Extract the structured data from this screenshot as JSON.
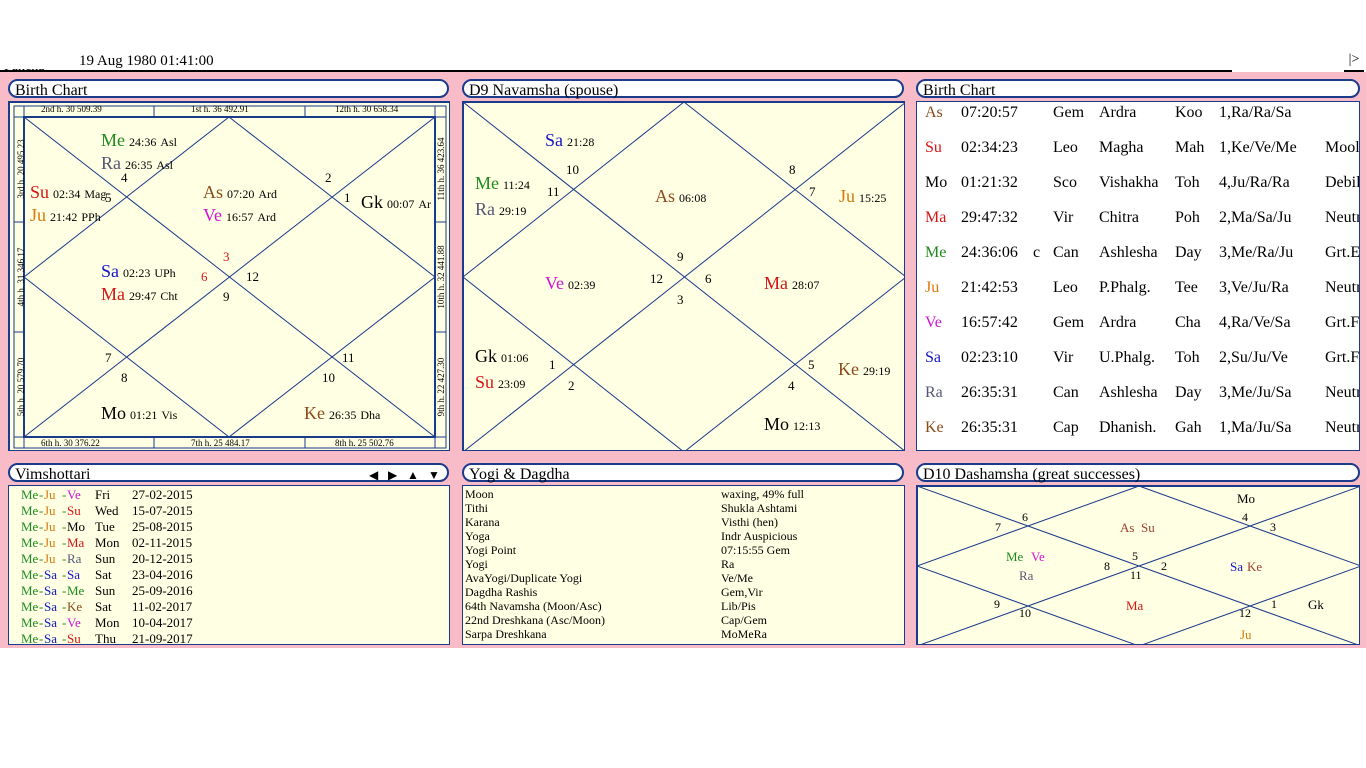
{
  "top": {
    "label": "Pañcha",
    "datetime": "19 Aug 1980 01:41:00",
    "nav_button": "|>"
  },
  "birth_chart": {
    "title": "Birth Chart",
    "strip_top": [
      "2nd h.  30  509.39",
      "1st h.  36  492.91",
      "12th h.  30  658.34"
    ],
    "strip_bottom": [
      "6th h.  30  376.22",
      "7th h.  25  484.17",
      "8th h.  25  502.76"
    ],
    "strip_left": [
      "3rd h.  20  495.23",
      "4th h.  31  346.17",
      "5th h.  20  579.70"
    ],
    "strip_right": [
      "11th h.  36  423.64",
      "10th h.  32  441.88",
      "9th h.  22  427.30"
    ],
    "planets": {
      "me": {
        "abbr": "Me",
        "deg": "24:36",
        "nak": "Asl"
      },
      "ra": {
        "abbr": "Ra",
        "deg": "26:35",
        "nak": "Asl"
      },
      "su": {
        "abbr": "Su",
        "deg": "02:34",
        "nak": "Mag"
      },
      "ju": {
        "abbr": "Ju",
        "deg": "21:42",
        "nak": "PPh"
      },
      "as": {
        "abbr": "As",
        "deg": "07:20",
        "nak": "Ard"
      },
      "ve": {
        "abbr": "Ve",
        "deg": "16:57",
        "nak": "Ard"
      },
      "gk": {
        "abbr": "Gk",
        "deg": "00:07",
        "nak": "Ar"
      },
      "sa": {
        "abbr": "Sa",
        "deg": "02:23",
        "nak": "UPh"
      },
      "ma": {
        "abbr": "Ma",
        "deg": "29:47",
        "nak": "Cht"
      },
      "mo": {
        "abbr": "Mo",
        "deg": "01:21",
        "nak": "Vis"
      },
      "ke": {
        "abbr": "Ke",
        "deg": "26:35",
        "nak": "Dha"
      }
    },
    "signs": {
      "s4": "4",
      "s5": "5",
      "s2": "2",
      "s1": "1",
      "s3": "3",
      "s6": "6",
      "s12": "12",
      "s9": "9",
      "s7": "7",
      "s8": "8",
      "s11": "11",
      "s10": "10"
    }
  },
  "d9": {
    "title": "D9 Navamsha  (spouse)",
    "planets": {
      "sa": {
        "abbr": "Sa",
        "deg": "21:28"
      },
      "me": {
        "abbr": "Me",
        "deg": "11:24"
      },
      "ra": {
        "abbr": "Ra",
        "deg": "29:19"
      },
      "as": {
        "abbr": "As",
        "deg": "06:08"
      },
      "ju": {
        "abbr": "Ju",
        "deg": "15:25"
      },
      "ve": {
        "abbr": "Ve",
        "deg": "02:39"
      },
      "ma": {
        "abbr": "Ma",
        "deg": "28:07"
      },
      "gk": {
        "abbr": "Gk",
        "deg": "01:06"
      },
      "su": {
        "abbr": "Su",
        "deg": "23:09"
      },
      "ke": {
        "abbr": "Ke",
        "deg": "29:19"
      },
      "mo": {
        "abbr": "Mo",
        "deg": "12:13"
      }
    },
    "signs": {
      "s10": "10",
      "s11": "11",
      "s8": "8",
      "s7": "7",
      "s9": "9",
      "s12": "12",
      "s6": "6",
      "s3": "3",
      "s1": "1",
      "s2": "2",
      "s5": "5",
      "s4": "4"
    }
  },
  "birth_table": {
    "title": "Birth Chart",
    "rows": [
      {
        "p": "As",
        "pos": "07:20:57",
        "r": "",
        "sign": "Gem",
        "nak": "Ardra",
        "lord": "Koo",
        "pada": "1,Ra/Ra/Sa",
        "status": ""
      },
      {
        "p": "Su",
        "pos": "02:34:23",
        "r": "",
        "sign": "Leo",
        "nak": "Magha",
        "lord": "Mah",
        "pada": "1,Ke/Ve/Me",
        "status": "Moolt"
      },
      {
        "p": "Mo",
        "pos": "01:21:32",
        "r": "",
        "sign": "Sco",
        "nak": "Vishakha",
        "lord": "Toh",
        "pada": "4,Ju/Ra/Ra",
        "status": "Debil."
      },
      {
        "p": "Ma",
        "pos": "29:47:32",
        "r": "",
        "sign": "Vir",
        "nak": "Chitra",
        "lord": "Poh",
        "pada": "2,Ma/Sa/Ju",
        "status": "Neutr"
      },
      {
        "p": "Me",
        "pos": "24:36:06",
        "r": "c",
        "sign": "Can",
        "nak": "Ashlesha",
        "lord": "Day",
        "pada": "3,Me/Ra/Ju",
        "status": "Grt.E"
      },
      {
        "p": "Ju",
        "pos": "21:42:53",
        "r": "",
        "sign": "Leo",
        "nak": "P.Phalg.",
        "lord": "Tee",
        "pada": "3,Ve/Ju/Ra",
        "status": "Neutr"
      },
      {
        "p": "Ve",
        "pos": "16:57:42",
        "r": "",
        "sign": "Gem",
        "nak": "Ardra",
        "lord": "Cha",
        "pada": "4,Ra/Ve/Sa",
        "status": "Grt.Fr"
      },
      {
        "p": "Sa",
        "pos": "02:23:10",
        "r": "",
        "sign": "Vir",
        "nak": "U.Phalg.",
        "lord": "Toh",
        "pada": "2,Su/Ju/Ve",
        "status": "Grt.Fr"
      },
      {
        "p": "Ra",
        "pos": "26:35:31",
        "r": "",
        "sign": "Can",
        "nak": "Ashlesha",
        "lord": "Day",
        "pada": "3,Me/Ju/Sa",
        "status": "Neutr"
      },
      {
        "p": "Ke",
        "pos": "26:35:31",
        "r": "",
        "sign": "Cap",
        "nak": "Dhanish.",
        "lord": "Gah",
        "pada": "1,Ma/Ju/Sa",
        "status": "Neutr"
      }
    ]
  },
  "vimshottari": {
    "title": "Vimshottari",
    "rows": [
      {
        "a": "Me",
        "b": "Ju",
        "c": "Ve",
        "day": "Fri",
        "date": "27-02-2015"
      },
      {
        "a": "Me",
        "b": "Ju",
        "c": "Su",
        "day": "Wed",
        "date": "15-07-2015"
      },
      {
        "a": "Me",
        "b": "Ju",
        "c": "Mo",
        "day": "Tue",
        "date": "25-08-2015"
      },
      {
        "a": "Me",
        "b": "Ju",
        "c": "Ma",
        "day": "Mon",
        "date": "02-11-2015"
      },
      {
        "a": "Me",
        "b": "Ju",
        "c": "Ra",
        "day": "Sun",
        "date": "20-12-2015"
      },
      {
        "a": "Me",
        "b": "Sa",
        "c": "Sa",
        "day": "Sat",
        "date": "23-04-2016"
      },
      {
        "a": "Me",
        "b": "Sa",
        "c": "Me",
        "day": "Sun",
        "date": "25-09-2016"
      },
      {
        "a": "Me",
        "b": "Sa",
        "c": "Ke",
        "day": "Sat",
        "date": "11-02-2017"
      },
      {
        "a": "Me",
        "b": "Sa",
        "c": "Ve",
        "day": "Mon",
        "date": "10-04-2017"
      },
      {
        "a": "Me",
        "b": "Sa",
        "c": "Su",
        "day": "Thu",
        "date": "21-09-2017"
      }
    ]
  },
  "yogi": {
    "title": "Yogi & Dagdha",
    "rows": [
      {
        "k": "Moon",
        "v": "waxing, 49% full"
      },
      {
        "k": "Tithi",
        "v": "Shukla Ashtami"
      },
      {
        "k": "Karana",
        "v": "Visthi (hen)"
      },
      {
        "k": "Yoga",
        "v": "Indr Auspicious"
      },
      {
        "k": "Yogi Point",
        "v": "07:15:55 Gem"
      },
      {
        "k": "Yogi",
        "v": "Ra"
      },
      {
        "k": "AvaYogi/Duplicate Yogi",
        "v": "Ve/Me"
      },
      {
        "k": "Dagdha Rashis",
        "v": "Gem,Vir"
      },
      {
        "k": "64th Navamsha (Moon/Asc)",
        "v": "Lib/Pis"
      },
      {
        "k": "22nd Dreshkana (Asc/Moon)",
        "v": "Cap/Gem"
      },
      {
        "k": "Sarpa Dreshkana",
        "v": "MoMeRa"
      }
    ]
  },
  "d10": {
    "title": "D10 Dashamsha  (great successes)",
    "labels": {
      "mo": "Mo",
      "as": "As",
      "su": "Su",
      "me": "Me",
      "ve": "Ve",
      "ra": "Ra",
      "sa": "Sa",
      "ke": "Ke",
      "ma": "Ma",
      "gk": "Gk",
      "ju": "Ju"
    },
    "signs": {
      "s6": "6",
      "s7": "7",
      "s4": "4",
      "s3": "3",
      "s5": "5",
      "s8": "8",
      "s2": "2",
      "s11": "11",
      "s9": "9",
      "s10": "10",
      "s12": "12",
      "s1": "1"
    }
  },
  "colors": {
    "pink_bg": "#f7bcc8",
    "panel_bg": "#ffffe3",
    "border": "#1a3a8a"
  }
}
